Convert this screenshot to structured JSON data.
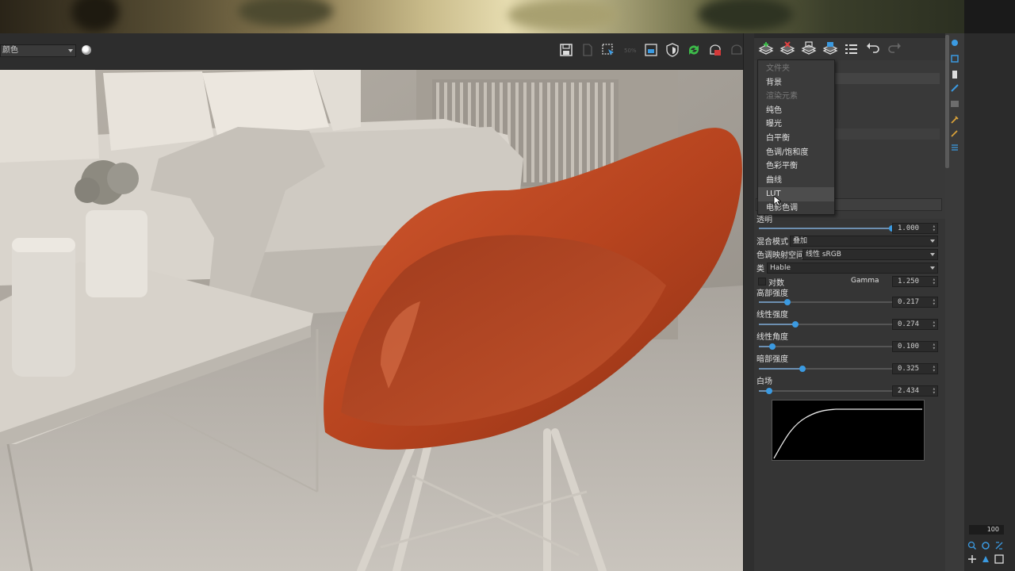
{
  "viewport_toolbar": {
    "channel_select_value": "颜色",
    "icons": [
      "save-icon",
      "clear-icon",
      "region-render-icon",
      "compare-icon",
      "window-icon",
      "shield-icon",
      "refresh-icon",
      "render-icon",
      "teapot-icon"
    ]
  },
  "layer_panel": {
    "toolbar_icons": [
      "add-layer-icon",
      "delete-layer-icon",
      "save-layers-icon",
      "load-layers-icon",
      "list-icon",
      "undo-icon",
      "redo-icon"
    ]
  },
  "add_layer_menu": {
    "items": [
      {
        "label": "文件夹",
        "disabled": true
      },
      {
        "label": "背景",
        "disabled": false
      },
      {
        "label": "渲染元素",
        "disabled": true
      },
      {
        "label": "纯色",
        "disabled": false
      },
      {
        "label": "曝光",
        "disabled": false
      },
      {
        "label": "白平衡",
        "disabled": false
      },
      {
        "label": "色调/饱和度",
        "disabled": false
      },
      {
        "label": "色彩平衡",
        "disabled": false
      },
      {
        "label": "曲线",
        "disabled": false
      },
      {
        "label": "LUT",
        "disabled": false,
        "hovered": true
      },
      {
        "label": "电影色调",
        "disabled": false
      }
    ]
  },
  "properties": {
    "opacity_label": "透明",
    "opacity_value": "1.000",
    "blend_mode_label": "混合模式",
    "blend_mode_value": "叠加",
    "colorspace_label": "色调映射空间",
    "colorspace_value": "线性 sRGB",
    "type_label": "类",
    "type_value": "Hable",
    "log_label": "对数",
    "gamma_label": "Gamma",
    "gamma_value": "1.250",
    "highlight_label": "高部强度",
    "highlight_value": "0.217",
    "linear_strength_label": "线性强度",
    "linear_strength_value": "0.274",
    "linear_angle_label": "线性角度",
    "linear_angle_value": "0.100",
    "shadow_label": "暗部强度",
    "shadow_value": "0.325",
    "white_label": "白场",
    "white_value": "2.434",
    "slider_levels": {
      "opacity": 1.0,
      "highlight": 0.217,
      "linear_strength": 0.274,
      "linear_angle": 0.1,
      "shadow": 0.325,
      "white": 0.08
    }
  },
  "timeline": {
    "frame_end": "100"
  },
  "colors": {
    "accent": "#3b9ae1",
    "panel_bg": "#353535",
    "chair": "#c24a24"
  }
}
